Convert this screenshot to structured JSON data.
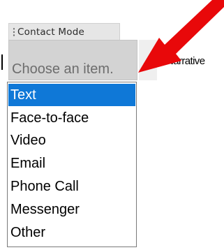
{
  "content_control": {
    "title": "Contact Mode",
    "placeholder": "Choose an item."
  },
  "document": {
    "following_text": "Narrative"
  },
  "dropdown": {
    "items": [
      {
        "label": "Text",
        "selected": true
      },
      {
        "label": "Face-to-face",
        "selected": false
      },
      {
        "label": "Video",
        "selected": false
      },
      {
        "label": "Email",
        "selected": false
      },
      {
        "label": "Phone Call",
        "selected": false
      },
      {
        "label": "Messenger",
        "selected": false
      },
      {
        "label": "Other",
        "selected": false
      }
    ]
  },
  "colors": {
    "selection": "#0f78d7",
    "pointer_arrow": "#e8080a",
    "placeholder_background": "#d3d3d3"
  },
  "icons": {
    "dropdown": "chevron-down-icon",
    "grip": "drag-handle-icon",
    "annotation": "red-arrow-icon"
  }
}
